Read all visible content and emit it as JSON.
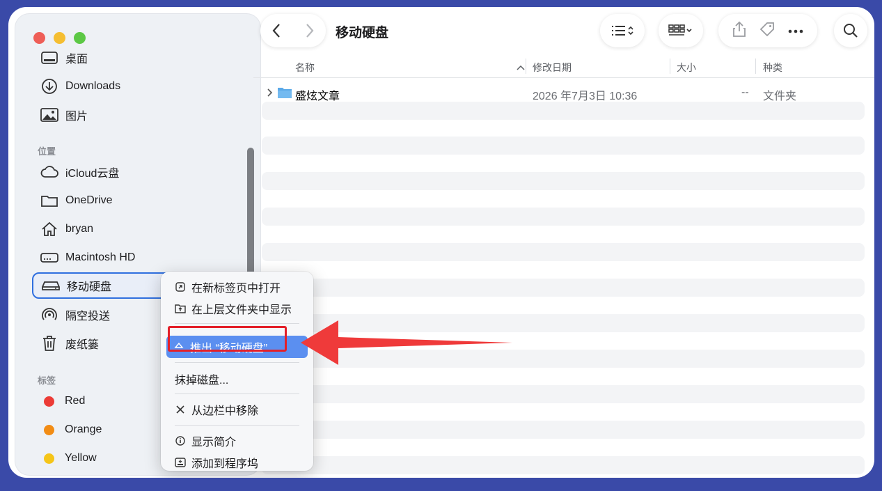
{
  "window": {
    "title": "移动硬盘"
  },
  "sidebar": {
    "top_items": [
      {
        "label": "桌面",
        "icon": "desktop-icon"
      },
      {
        "label": "Downloads",
        "icon": "download-circle-icon"
      },
      {
        "label": "图片",
        "icon": "photo-icon"
      }
    ],
    "locations_header": "位置",
    "locations": [
      {
        "label": "iCloud云盘",
        "icon": "cloud-icon"
      },
      {
        "label": "OneDrive",
        "icon": "folder-icon"
      },
      {
        "label": "bryan",
        "icon": "home-icon"
      },
      {
        "label": "Macintosh HD",
        "icon": "hard-drive-icon"
      },
      {
        "label": "移动硬盘",
        "icon": "external-drive-icon",
        "selected": true
      },
      {
        "label": "隔空投送",
        "icon": "airdrop-icon"
      },
      {
        "label": "废纸篓",
        "icon": "trash-icon"
      }
    ],
    "tags_header": "标签",
    "tags": [
      {
        "label": "Red",
        "color": "#ec3b36"
      },
      {
        "label": "Orange",
        "color": "#f28c14"
      },
      {
        "label": "Yellow",
        "color": "#f5c518"
      }
    ]
  },
  "columns": {
    "name": "名称",
    "modified": "修改日期",
    "size": "大小",
    "kind": "种类"
  },
  "files": [
    {
      "name": "盛炫文章",
      "modified": "2026 年7月3日 10:36",
      "size": "--",
      "kind": "文件夹"
    }
  ],
  "context_menu": {
    "items": [
      {
        "label": "在新标签页中打开",
        "icon": "open-in-tab-icon"
      },
      {
        "label": "在上层文件夹中显示",
        "icon": "show-in-folder-icon"
      },
      {
        "label": "推出 “移动硬盘”",
        "icon": "eject-icon",
        "highlighted": true
      },
      {
        "label": "抹掉磁盘...",
        "icon": ""
      },
      {
        "label": "从边栏中移除",
        "icon": "close-x-icon"
      },
      {
        "label": "显示简介",
        "icon": "info-icon"
      },
      {
        "label": "添加到程序坞",
        "icon": "dock-icon"
      }
    ]
  },
  "colors": {
    "accent": "#5b8ff0",
    "annotation": "#e3202a",
    "selection_border": "#2f6fdf"
  }
}
